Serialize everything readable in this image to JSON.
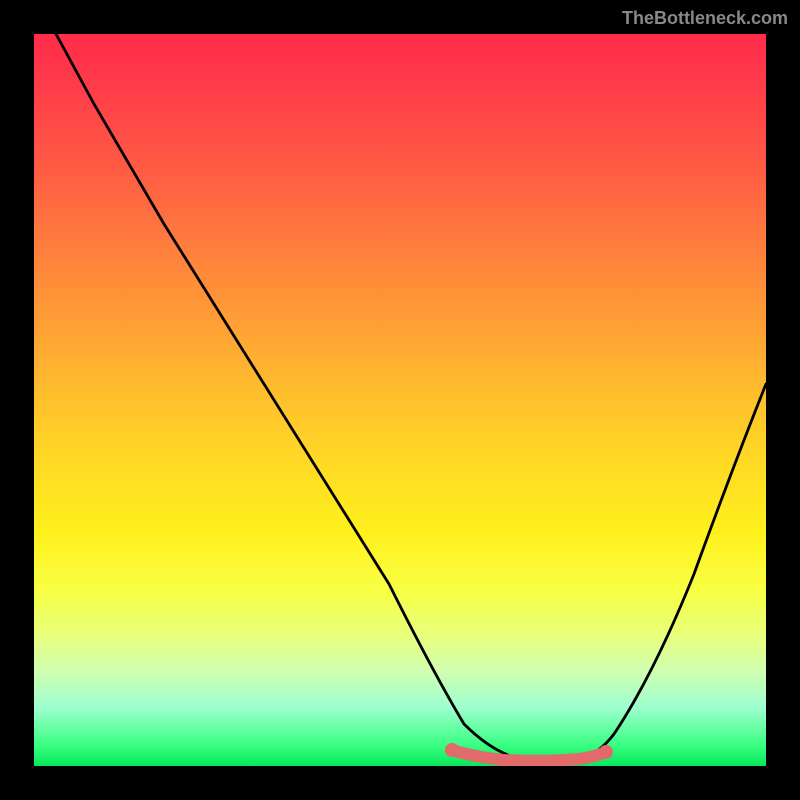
{
  "watermark": "TheBottleneck.com",
  "chart_data": {
    "type": "line",
    "title": "",
    "xlabel": "",
    "ylabel": "",
    "xlim": [
      0,
      100
    ],
    "ylim": [
      0,
      100
    ],
    "series": [
      {
        "name": "bottleneck-curve",
        "x": [
          3,
          10,
          20,
          30,
          40,
          50,
          57,
          62,
          66,
          70,
          74,
          78,
          85,
          92,
          100
        ],
        "y": [
          100,
          88,
          72,
          56,
          40,
          24,
          12,
          4,
          1,
          0,
          0,
          1,
          8,
          22,
          42
        ],
        "color": "#000000"
      },
      {
        "name": "optimal-band",
        "x": [
          57,
          60,
          64,
          68,
          72,
          76,
          78
        ],
        "y": [
          2.0,
          1.2,
          0.8,
          0.7,
          0.7,
          1.0,
          1.6
        ],
        "color": "#e26a6a"
      }
    ],
    "markers": [
      {
        "x": 57,
        "y": 2.0,
        "color": "#e26a6a"
      },
      {
        "x": 78,
        "y": 1.6,
        "color": "#e26a6a"
      }
    ],
    "gradient_stops": [
      {
        "pos": 0,
        "color": "#ff2b4a"
      },
      {
        "pos": 50,
        "color": "#ffd000"
      },
      {
        "pos": 80,
        "color": "#f8ff44"
      },
      {
        "pos": 100,
        "color": "#06e85a"
      }
    ]
  }
}
